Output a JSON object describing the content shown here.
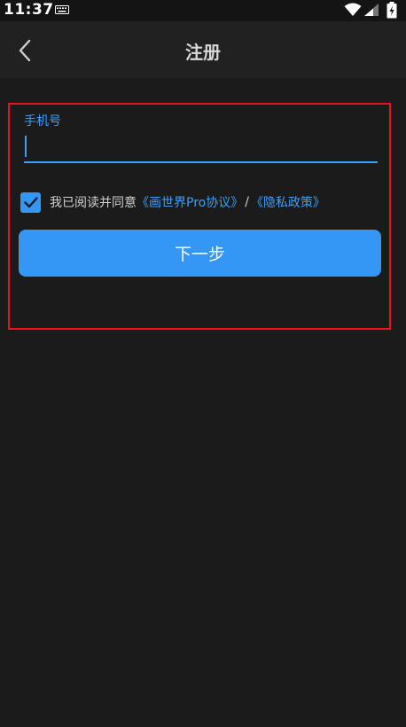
{
  "status_bar": {
    "time": "11:37",
    "icons": [
      "keyboard-icon",
      "wifi-icon",
      "signal-icon",
      "battery-icon"
    ]
  },
  "app_bar": {
    "title": "注册",
    "back_icon": "chevron-left-icon"
  },
  "form": {
    "phone_label": "手机号",
    "phone_value": "",
    "agree_checked": true,
    "agree_prefix": "我已阅读并同意",
    "agreement_link": "《画世界Pro协议》",
    "separator": "/",
    "privacy_link": "《隐私政策》",
    "next_button": "下一步"
  },
  "colors": {
    "background": "#1b1b1c",
    "appbar": "#212122",
    "accent": "#3497f5",
    "highlight_border": "#e8121b"
  }
}
